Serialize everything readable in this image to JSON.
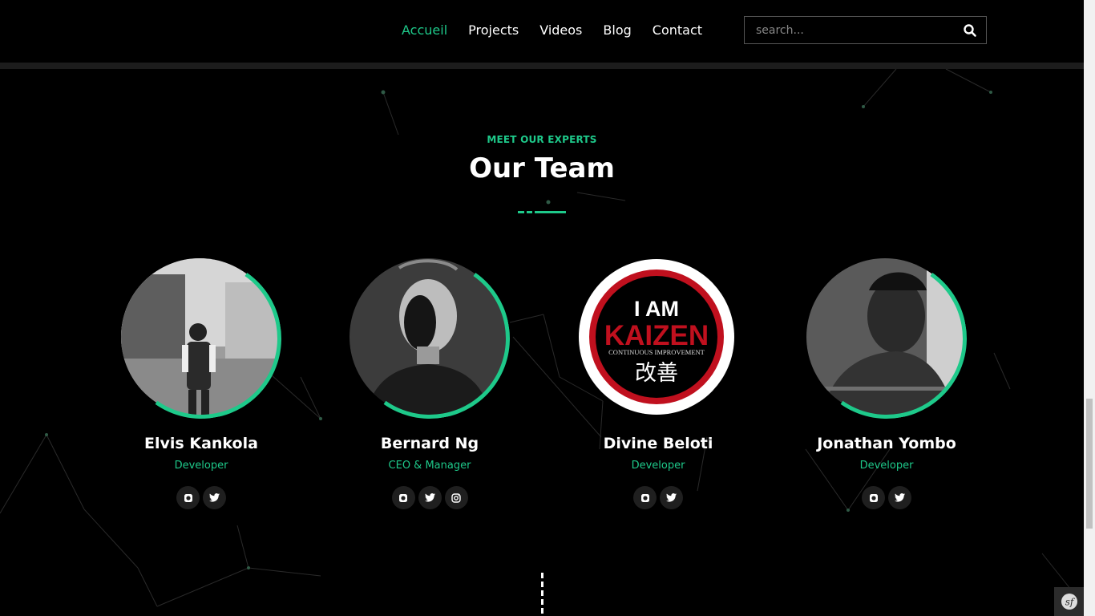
{
  "header": {
    "nav": [
      "Accueil",
      "Projects",
      "Videos",
      "Blog",
      "Contact"
    ],
    "active_nav": "Accueil",
    "search_placeholder": "search..."
  },
  "section": {
    "eyebrow": "MEET OUR EXPERTS",
    "title": "Our Team"
  },
  "team": [
    {
      "name": "Elvis Kankola",
      "role": "Developer",
      "socials": [
        "github-icon",
        "twitter-icon"
      ]
    },
    {
      "name": "Bernard Ng",
      "role": "CEO & Manager",
      "socials": [
        "github-icon",
        "twitter-icon",
        "instagram-icon"
      ]
    },
    {
      "name": "Divine Beloti",
      "role": "Developer",
      "socials": [
        "github-icon",
        "twitter-icon"
      ]
    },
    {
      "name": "Jonathan Yombo",
      "role": "Developer",
      "socials": [
        "github-icon",
        "twitter-icon"
      ]
    }
  ],
  "kaizen_logo": {
    "line1": "I AM",
    "line2": "KAIZEN",
    "line3": "CONTINUOUS IMPROVEMENT",
    "line4": "改善"
  },
  "colors": {
    "accent": "#1ec98a",
    "background": "#000000",
    "kaizen_red": "#c0101e"
  }
}
